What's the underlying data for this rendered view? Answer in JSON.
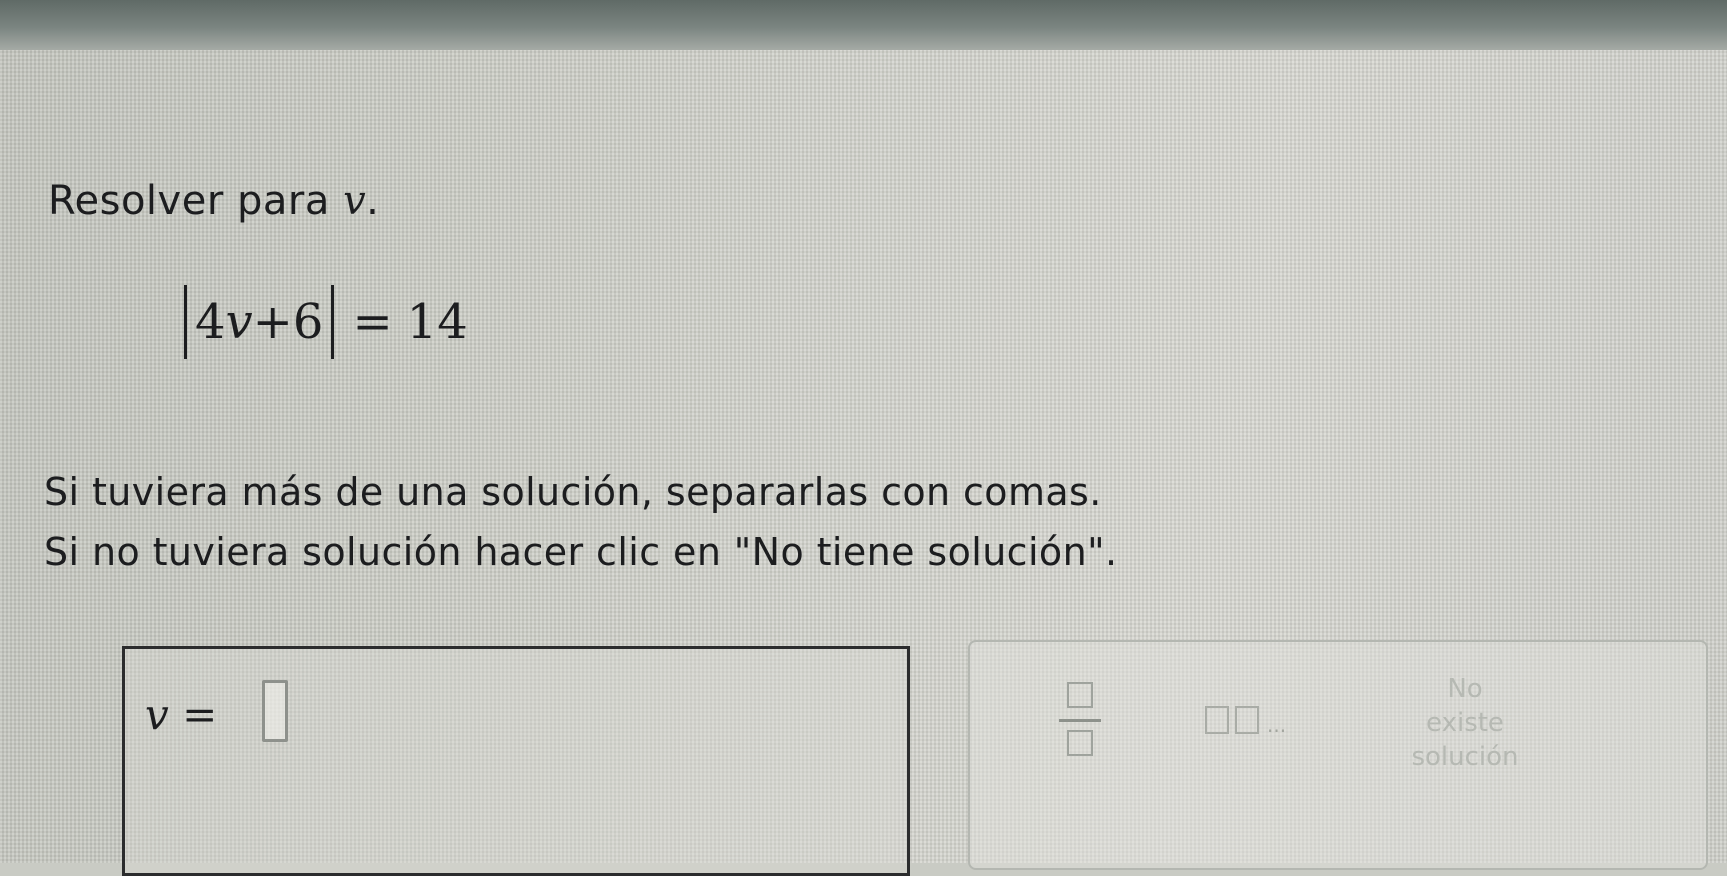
{
  "problem": {
    "heading_text": "Resolver para",
    "variable": "v",
    "heading_end": ".",
    "equation": {
      "coef": "4",
      "var": "v",
      "op": "+",
      "const": "6",
      "equals": "=",
      "rhs": "14"
    },
    "instruction_1": "Si tuviera más de una solución, separarlas con comas.",
    "instruction_2": "Si no tuviera solución hacer clic en \"No tiene solución\"."
  },
  "answer": {
    "label": "v =",
    "value": ""
  },
  "tools": {
    "no_solution": {
      "line1": "No",
      "line2": "existe",
      "line3": "solución"
    },
    "list_dots": "..."
  },
  "colors": {
    "text": "#1c1d1f",
    "muted": "#b6b9b3"
  },
  "icons": {
    "fraction": "fraction-icon",
    "list": "list-icon"
  }
}
